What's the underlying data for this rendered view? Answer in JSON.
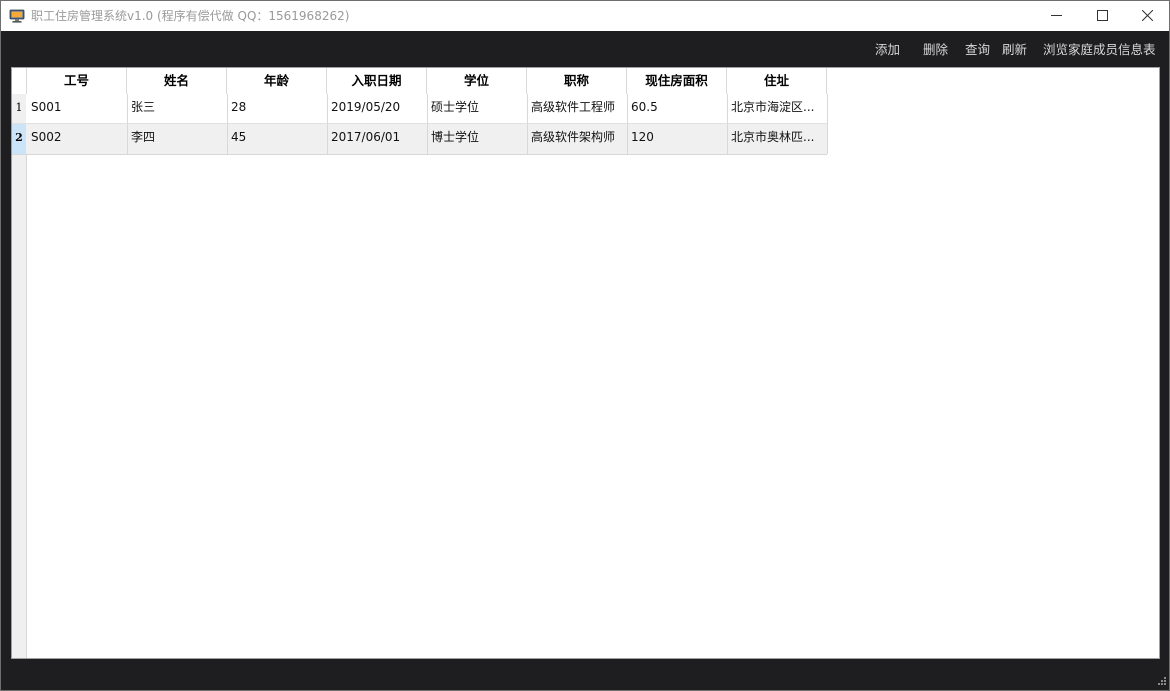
{
  "window": {
    "title": "职工住房管理系统v1.0 (程序有偿代做 QQ：1561968262)"
  },
  "toolbar": {
    "add_label": "添加",
    "delete_label": "删除",
    "query_label": "查询",
    "refresh_label": "刷新",
    "family_label": "浏览家庭成员信息表"
  },
  "table": {
    "columns": [
      "工号",
      "姓名",
      "年龄",
      "入职日期",
      "学位",
      "职称",
      "现住房面积",
      "住址"
    ],
    "rows": [
      {
        "num": "1",
        "cells": [
          "S001",
          "张三",
          "28",
          "2019/05/20",
          "硕士学位",
          "高级软件工程师",
          "60.5",
          "北京市海淀区..."
        ]
      },
      {
        "num": "2",
        "cells": [
          "S002",
          "李四",
          "45",
          "2017/06/01",
          "博士学位",
          "高级软件架构师",
          "120",
          "北京市奥林匹..."
        ]
      }
    ],
    "selected_row": 2
  },
  "icons": {
    "app": "computer-monitor-icon",
    "minimize": "minimize-icon",
    "maximize": "maximize-icon",
    "close": "close-icon",
    "grip": "resize-grip-icon"
  },
  "colors": {
    "chrome_dark": "#1e1e20",
    "selected_row_header": "#cce4f7",
    "alt_row": "#f0f0f0"
  }
}
